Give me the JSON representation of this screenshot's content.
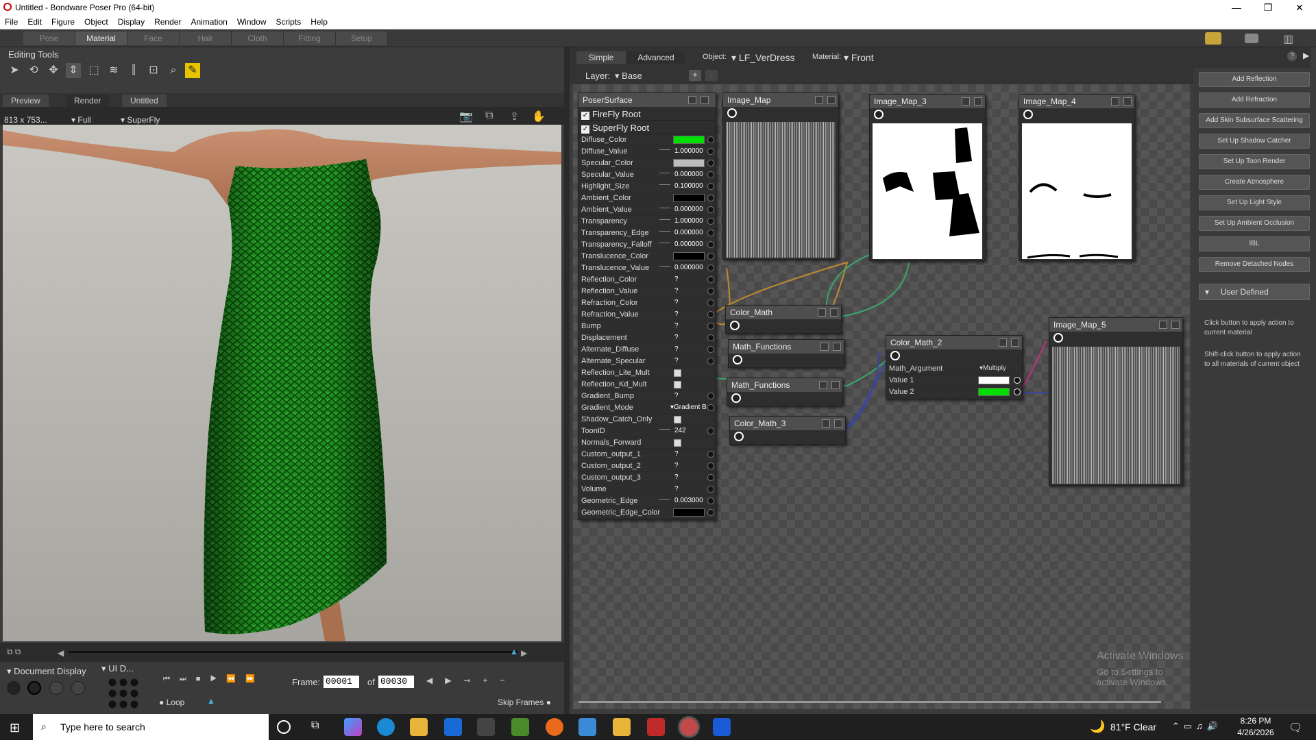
{
  "titlebar": {
    "title": "Untitled - Bondware Poser Pro  (64-bit)",
    "minimize": "—",
    "maximize": "❐",
    "close": "✕"
  },
  "menu": [
    "File",
    "Edit",
    "Figure",
    "Object",
    "Display",
    "Render",
    "Animation",
    "Window",
    "Scripts",
    "Help"
  ],
  "rooms": [
    "Pose",
    "Material",
    "Face",
    "Hair",
    "Cloth",
    "Fitting",
    "Setup"
  ],
  "active_room": "Material",
  "editing_tools": {
    "label": "Editing Tools"
  },
  "view_tabs": {
    "preview": "Preview",
    "render": "Render",
    "doc": "Untitled"
  },
  "view_header": {
    "size": "813 x 753...",
    "full": "Full",
    "engine": "SuperFly"
  },
  "document_display": {
    "label": "Document Display",
    "ui": "UI D..."
  },
  "playback": {
    "frame_label": "Frame:",
    "frame": "00001",
    "of": "of",
    "total": "00030",
    "loop": "Loop",
    "skip_frames": "Skip Frames"
  },
  "material_bar": {
    "simple": "Simple",
    "advanced": "Advanced",
    "object_label": "Object:",
    "object": "LF_VerDress",
    "material_label": "Material:",
    "material": "Front",
    "layer_label": "Layer:",
    "layer": "Base",
    "add": "+",
    "remove": "-"
  },
  "poser_surface": {
    "title": "PoserSurface",
    "roots": [
      "FireFly Root",
      "SuperFly Root"
    ],
    "props": [
      {
        "label": "Diffuse_Color",
        "type": "color",
        "color": "#00e000"
      },
      {
        "label": "Diffuse_Value",
        "type": "num",
        "value": "1.000000"
      },
      {
        "label": "Specular_Color",
        "type": "color",
        "color": "#bdbdbd"
      },
      {
        "label": "Specular_Value",
        "type": "num",
        "value": "0.000000"
      },
      {
        "label": "Highlight_Size",
        "type": "num",
        "value": "0.100000"
      },
      {
        "label": "Ambient_Color",
        "type": "color",
        "color": "#000000"
      },
      {
        "label": "Ambient_Value",
        "type": "num",
        "value": "0.000000"
      },
      {
        "label": "Transparency",
        "type": "num",
        "value": "1.000000"
      },
      {
        "label": "Transparency_Edge",
        "type": "num",
        "value": "0.000000"
      },
      {
        "label": "Transparency_Falloff",
        "type": "num",
        "value": "0.000000"
      },
      {
        "label": "Translucence_Color",
        "type": "color",
        "color": "#000000"
      },
      {
        "label": "Translucence_Value",
        "type": "num",
        "value": "0.000000"
      },
      {
        "label": "Reflection_Color",
        "type": "q",
        "value": "?"
      },
      {
        "label": "Reflection_Value",
        "type": "q",
        "value": "?"
      },
      {
        "label": "Refraction_Color",
        "type": "q",
        "value": "?"
      },
      {
        "label": "Refraction_Value",
        "type": "q",
        "value": "?"
      },
      {
        "label": "Bump",
        "type": "q",
        "value": "?"
      },
      {
        "label": "Displacement",
        "type": "q",
        "value": "?"
      },
      {
        "label": "Alternate_Diffuse",
        "type": "q",
        "value": "?"
      },
      {
        "label": "Alternate_Specular",
        "type": "q",
        "value": "?"
      },
      {
        "label": "Reflection_Lite_Mult",
        "type": "check"
      },
      {
        "label": "Reflection_Kd_Mult",
        "type": "check"
      },
      {
        "label": "Gradient_Bump",
        "type": "q",
        "value": "?"
      },
      {
        "label": "Gradient_Mode",
        "type": "text",
        "value": "▾Gradient B"
      },
      {
        "label": "Shadow_Catch_Only",
        "type": "check"
      },
      {
        "label": "ToonID",
        "type": "num",
        "value": "242"
      },
      {
        "label": "Normals_Forward",
        "type": "check"
      },
      {
        "label": "Custom_output_1",
        "type": "q",
        "value": "?"
      },
      {
        "label": "Custom_output_2",
        "type": "q",
        "value": "?"
      },
      {
        "label": "Custom_output_3",
        "type": "q",
        "value": "?"
      },
      {
        "label": "Volume",
        "type": "q",
        "value": "?"
      },
      {
        "label": "Geometric_Edge",
        "type": "num",
        "value": "0.003000"
      },
      {
        "label": "Geometric_Edge_Color",
        "type": "color",
        "color": "#000000"
      }
    ]
  },
  "nodes": {
    "image_map": "Image_Map",
    "image_map_3": "Image_Map_3",
    "image_map_4": "Image_Map_4",
    "image_map_5": "Image_Map_5",
    "color_math": "Color_Math",
    "math_functions_1": "Math_Functions",
    "math_functions_2": "Math_Functions",
    "color_math_3": "Color_Math_3",
    "color_math_2": {
      "title": "Color_Math_2",
      "arg_label": "Math_Argument",
      "arg": "▾Multiply",
      "value1": "Value 1",
      "value2": "Value 2",
      "value1_color": "#ffffff",
      "value2_color": "#00dd00"
    }
  },
  "wizards": [
    "Add Reflection",
    "Add Refraction",
    "Add Skin Subsurface Scattering",
    "Set Up Shadow Catcher",
    "Set Up Toon Render",
    "Create Atmosphere",
    "Set Up Light Style",
    "Set Up Ambient Occlusion",
    "IBL",
    "Remove Detached Nodes"
  ],
  "user_defined": {
    "label": "User Defined",
    "help1": "Click button to apply action to current material",
    "help2": "Shift-click button to apply action to all materials of current object"
  },
  "watermark": {
    "line1": "Activate Windows",
    "line2": "Go to Settings to activate Windows."
  },
  "taskbar": {
    "search": "Type here to search",
    "weather": "81°F  Clear",
    "time": "8:26 PM",
    "date": "4/26/2026"
  },
  "colors": {
    "accent_green": "#00e000",
    "dress_green": "#1e8c1e",
    "selected_tool": "#e8c400"
  }
}
